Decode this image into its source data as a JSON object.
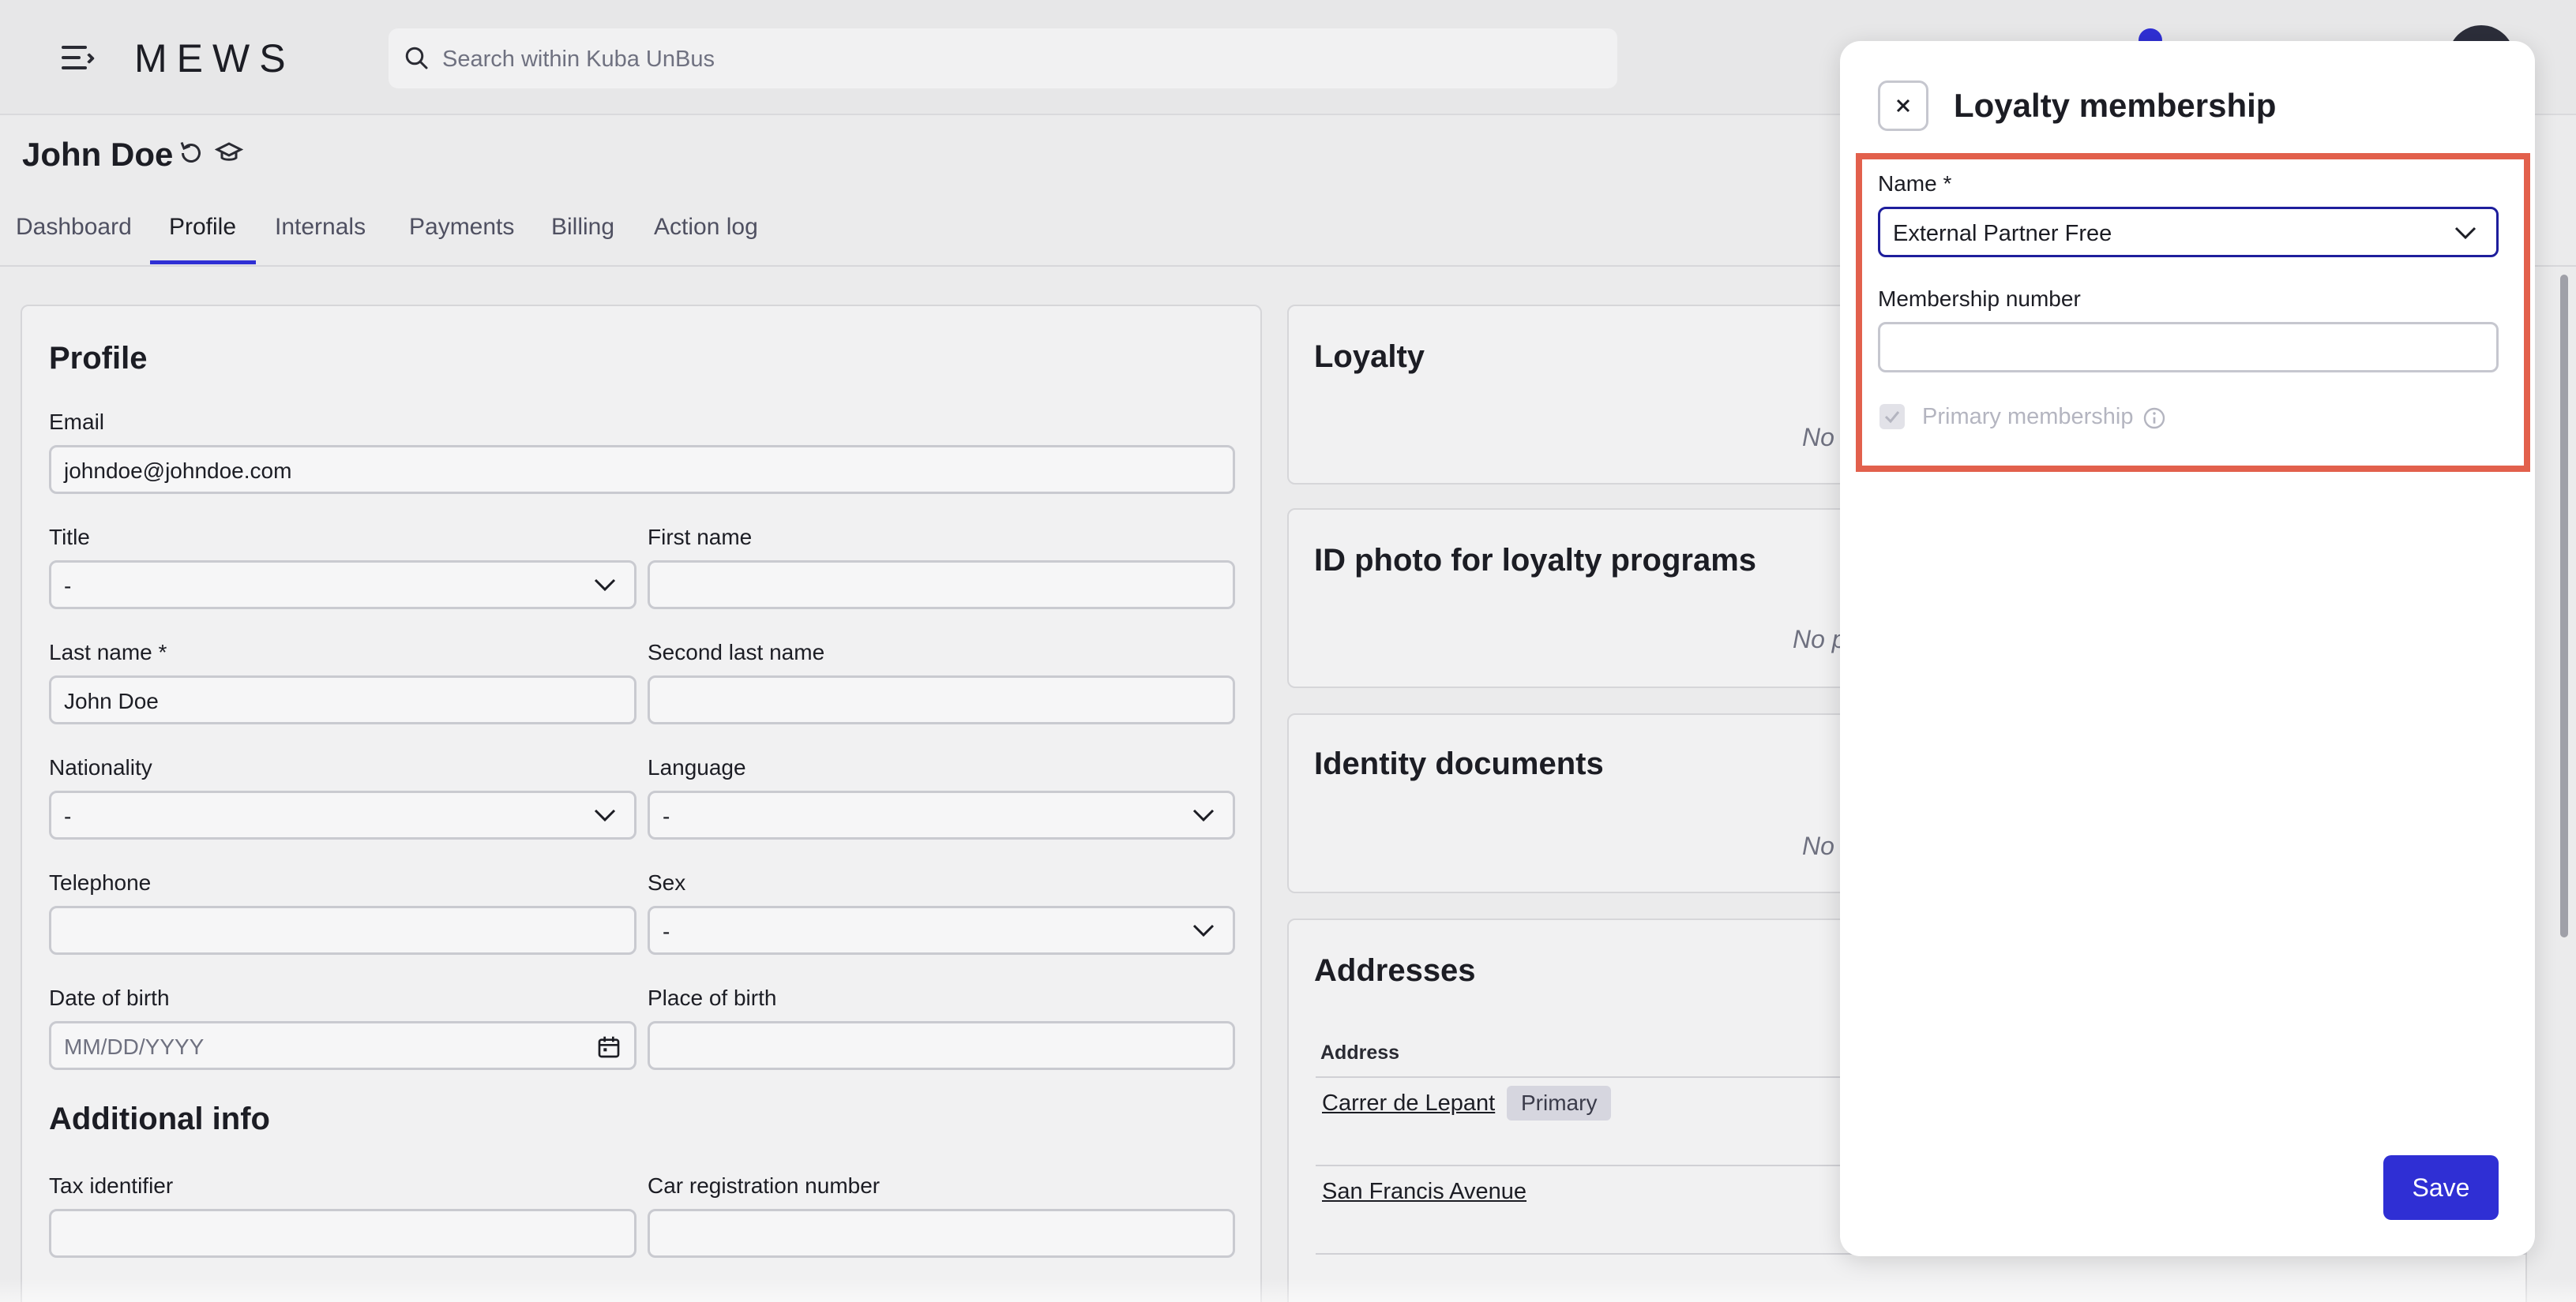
{
  "topbar": {
    "logo": "MEWS",
    "search_placeholder": "Search within Kuba UnBus"
  },
  "guest": {
    "name": "John Doe"
  },
  "tabs": [
    {
      "label": "Dashboard"
    },
    {
      "label": "Profile"
    },
    {
      "label": "Internals"
    },
    {
      "label": "Payments"
    },
    {
      "label": "Billing"
    },
    {
      "label": "Action log"
    }
  ],
  "profile": {
    "title": "Profile",
    "email_label": "Email",
    "email_value": "johndoe@johndoe.com",
    "title_label": "Title",
    "title_value": "-",
    "first_name_label": "First name",
    "first_name_value": "",
    "last_name_label": "Last name *",
    "last_name_value": "John Doe",
    "second_last_name_label": "Second last name",
    "second_last_name_value": "",
    "nationality_label": "Nationality",
    "nationality_value": "-",
    "language_label": "Language",
    "language_value": "-",
    "telephone_label": "Telephone",
    "telephone_value": "",
    "sex_label": "Sex",
    "sex_value": "-",
    "dob_label": "Date of birth",
    "dob_placeholder": "MM/DD/YYYY",
    "pob_label": "Place of birth",
    "pob_value": "",
    "additional_title": "Additional info",
    "tax_label": "Tax identifier",
    "car_label": "Car registration number"
  },
  "right_cards": {
    "loyalty_title": "Loyalty",
    "loyalty_empty": "No",
    "idphoto_title": "ID photo for loyalty programs",
    "idphoto_empty": "No p",
    "identity_title": "Identity documents",
    "identity_empty": "No",
    "addresses_title": "Addresses",
    "address_col": "Address",
    "addresses": [
      {
        "name": "Carrer de Lepant",
        "badge": "Primary"
      },
      {
        "name": "San Francis Avenue"
      }
    ]
  },
  "panel": {
    "title": "Loyalty membership",
    "name_label": "Name *",
    "name_value": "External Partner Free",
    "membership_number_label": "Membership number",
    "membership_number_value": "",
    "primary_label": "Primary membership",
    "primary_checked": true,
    "save_label": "Save"
  },
  "colors": {
    "accent": "#2f2fd4",
    "highlight": "#e2604c"
  }
}
